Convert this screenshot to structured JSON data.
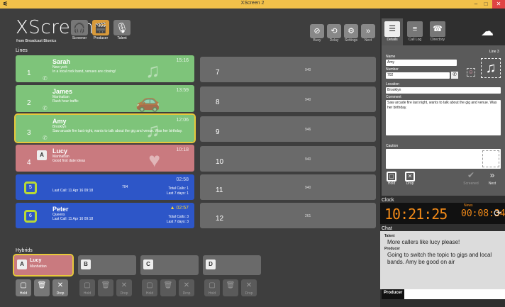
{
  "window": {
    "title": "XScreen 2",
    "minimize": "–",
    "maximize": "□",
    "close": "✕"
  },
  "brand": {
    "logo": "XScreen",
    "subtitle": "from Broadcast Bionics"
  },
  "modes": [
    {
      "label": "Screener",
      "icon": "headphones-icon",
      "glyph": "🎧"
    },
    {
      "label": "Producer",
      "icon": "clapper-icon",
      "glyph": "🎬"
    },
    {
      "label": "Talent",
      "icon": "microphone-icon",
      "glyph": "🎙"
    }
  ],
  "toolbar": [
    {
      "label": "Busy",
      "glyph": "⊘"
    },
    {
      "label": "Delay",
      "glyph": "⟲"
    },
    {
      "label": "Settings",
      "glyph": "⚙"
    },
    {
      "label": "Next",
      "glyph": "»"
    }
  ],
  "sections": {
    "lines": "Lines",
    "hybrids": "Hybrids",
    "clock": "Clock",
    "chat": "Chat"
  },
  "lines_left": [
    {
      "num": "1",
      "name": "Sarah",
      "location": "New york",
      "comment": "In a local rock band, venues are closing!",
      "time": "15:16",
      "glyph": "♫",
      "color": "green"
    },
    {
      "num": "2",
      "name": "James",
      "location": "Manhattan",
      "comment": "Rush hour traffic",
      "time": "13:59",
      "glyph": "🚗",
      "color": "green"
    },
    {
      "num": "3",
      "name": "Amy",
      "location": "Brooklyn",
      "comment": "Saw arcade fire last night, wants to talk about the gig and venue. Was her birthday.",
      "time": "12:06",
      "glyph": "♫",
      "color": "green",
      "highlight": true
    },
    {
      "num": "4",
      "name": "Lucy",
      "location": "Manhattan",
      "comment": "Good first date ideas",
      "time": "10:18",
      "glyph": "♥",
      "color": "pink",
      "tag": "A"
    }
  ],
  "blue_lines": [
    {
      "num": "5",
      "name": "",
      "lastcall": "Last Call: 11 Apr 16 09:18",
      "middle": "704",
      "time": "02:58",
      "total_calls": "Total Calls: 1",
      "last7": "Last 7 days: 1"
    },
    {
      "num": "6",
      "name": "Peter",
      "location": "Queens",
      "lastcall": "Last Call: 11 Apr 16 09:18",
      "middle": "",
      "time": "02:57",
      "total_calls": "Total Calls: 3",
      "last7": "Last 7 days: 3"
    }
  ],
  "lines_right": [
    {
      "num": "7",
      "value": "940"
    },
    {
      "num": "8",
      "value": "940"
    },
    {
      "num": "9",
      "value": "946"
    },
    {
      "num": "10",
      "value": "940"
    },
    {
      "num": "11",
      "value": "940"
    },
    {
      "num": "12",
      "value": "261"
    }
  ],
  "hybrids": [
    {
      "letter": "A",
      "name": "Lucy",
      "location": "Manhattan",
      "active": true
    },
    {
      "letter": "B",
      "name": "",
      "location": "",
      "active": false
    },
    {
      "letter": "C",
      "name": "",
      "location": "",
      "active": false
    },
    {
      "letter": "D",
      "name": "",
      "location": "",
      "active": false
    }
  ],
  "hybrid_buttons": {
    "hold": "Hold",
    "drop": "Drop"
  },
  "tabs": [
    {
      "label": "Details",
      "glyph": "☰"
    },
    {
      "label": "Call Log",
      "glyph": "≡"
    },
    {
      "label": "Directory",
      "glyph": "☎"
    }
  ],
  "details": {
    "line_label": "Line 3",
    "name_label": "Name",
    "name_value": "Amy",
    "number_label": "Number",
    "number_value": "702",
    "location_label": "Location",
    "location_value": "Brooklyn",
    "comment_label": "Comment",
    "comment_value": "Saw arcade fire last night, wants to talk about the gig and venue. Was her birthday.",
    "caution_label": "Caution",
    "buttons": {
      "hold": "Hold",
      "drop": "Drop",
      "screened": "Screened",
      "next": "Next"
    }
  },
  "clock": {
    "time": "10:21:25",
    "news_label": "News",
    "news_time": "00:08:34"
  },
  "chat": {
    "messages": [
      {
        "from": "Talent",
        "text": "More callers like lucy please!"
      },
      {
        "from": "Producer",
        "text": "Going to switch the topic to gigs and local bands. Amy be good on air"
      }
    ],
    "input_role": "Producer"
  }
}
